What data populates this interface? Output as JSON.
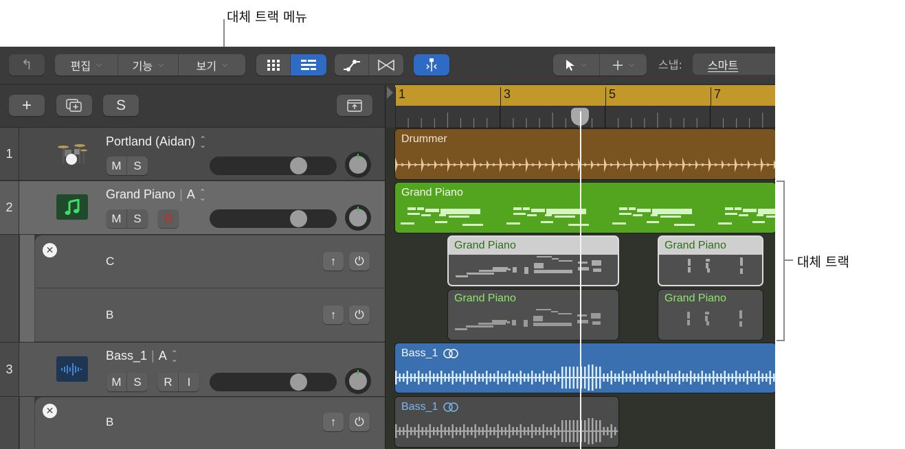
{
  "annotations": {
    "take_menu_label": "대체 트랙 메뉴",
    "take_tracks_label": "대체 트랙"
  },
  "toolbar": {
    "back_icon": "catch-playhead-icon",
    "menus": [
      {
        "label": "편집",
        "icon": "chevron-down-icon"
      },
      {
        "label": "기능",
        "icon": "chevron-down-icon"
      },
      {
        "label": "보기",
        "icon": "chevron-down-icon"
      }
    ],
    "view_buttons": [
      {
        "icon": "grid-view-icon",
        "active": false
      },
      {
        "icon": "list-view-icon",
        "active": true
      }
    ],
    "automation_buttons": [
      {
        "icon": "automation-icon"
      },
      {
        "icon": "flex-icon"
      }
    ],
    "snap_alignment_icon": "snap-guides-icon",
    "pointer_tool_icon": "pointer-icon",
    "secondary_tool_icon": "crosshair-icon",
    "snap_label": "스냅:",
    "snap_value": "스마트",
    "accent_color": "#2d6bc4"
  },
  "header_row": {
    "add_track_label": "+",
    "duplicate_track_icon": "duplicate-track-icon",
    "solo_label": "S",
    "upload_icon": "upload-icon"
  },
  "ruler": {
    "bars": [
      "1",
      "3",
      "5",
      "7"
    ],
    "color": "#c3982a"
  },
  "tracks": [
    {
      "number": "1",
      "name": "Portland (Aidan)",
      "take_letter": "",
      "icon": "drum-kit-icon",
      "buttons": [
        "M",
        "S"
      ],
      "volume": 0.7,
      "region": {
        "title": "Drummer",
        "color": "#7a5420"
      }
    },
    {
      "number": "2",
      "name": "Grand Piano",
      "take_letter": "A",
      "icon": "music-note-icon",
      "buttons": [
        "M",
        "S"
      ],
      "record_label": "R",
      "volume": 0.7,
      "region": {
        "title": "Grand Piano",
        "color": "#53a41e"
      },
      "takes": [
        {
          "name": "C",
          "regions": [
            "Grand Piano",
            "Grand Piano"
          ]
        },
        {
          "name": "B",
          "regions": [
            "Grand Piano",
            "Grand Piano"
          ]
        }
      ]
    },
    {
      "number": "3",
      "name": "Bass_1",
      "take_letter": "A",
      "icon": "waveform-icon",
      "buttons": [
        "M",
        "S"
      ],
      "extra_buttons": [
        "R",
        "I"
      ],
      "volume": 0.7,
      "region": {
        "title": "Bass_1",
        "color": "#3a70b0"
      },
      "takes": [
        {
          "name": "B",
          "regions": [
            "Bass_1"
          ]
        }
      ]
    }
  ]
}
